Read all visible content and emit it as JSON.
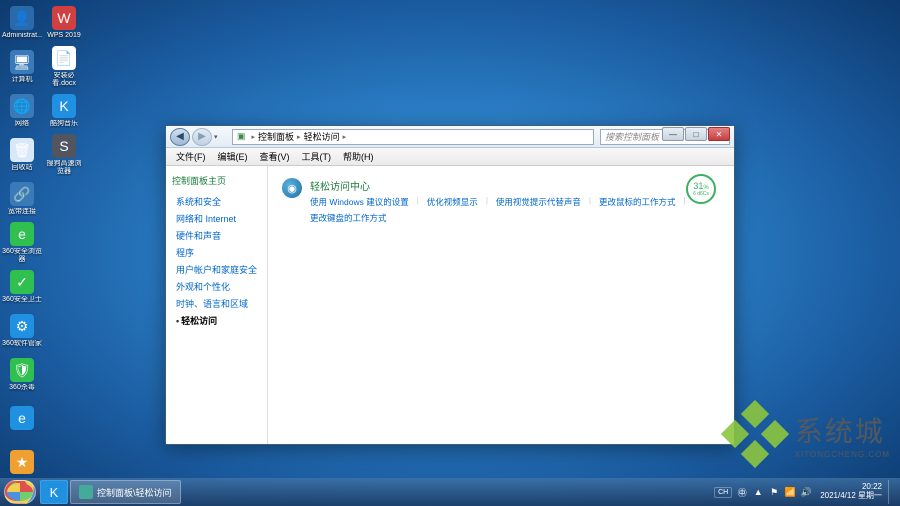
{
  "desktop": {
    "col1": [
      {
        "label": "Administrat...",
        "color": "#2a6aaa",
        "glyph": "👤"
      },
      {
        "label": "计算机",
        "color": "#3a7ab8",
        "glyph": "🖥"
      },
      {
        "label": "网络",
        "color": "#3a7ab8",
        "glyph": "🌐"
      },
      {
        "label": "回收站",
        "color": "#d8e8f8",
        "glyph": "🗑"
      },
      {
        "label": "宽带连接",
        "color": "#3a7ab8",
        "glyph": "🔗"
      },
      {
        "label": "360安全浏览器",
        "color": "#30c050",
        "glyph": "e"
      },
      {
        "label": "360安全卫士",
        "color": "#30c050",
        "glyph": "✓"
      },
      {
        "label": "360软件管家",
        "color": "#2090e0",
        "glyph": "⚙"
      },
      {
        "label": "360杀毒",
        "color": "#30c050",
        "glyph": "🛡"
      },
      {
        "label": "",
        "color": "#2090e0",
        "glyph": "e"
      },
      {
        "label": "",
        "color": "#f0a030",
        "glyph": "★"
      }
    ],
    "col2": [
      {
        "label": "WPS 2019",
        "color": "#d04040",
        "glyph": "W"
      },
      {
        "label": "安装必看.docx",
        "color": "#ffffff",
        "glyph": "📄"
      },
      {
        "label": "酷狗音乐",
        "color": "#2090e0",
        "glyph": "K"
      },
      {
        "label": "搜狗高速浏览器",
        "color": "#505560",
        "glyph": "S"
      }
    ]
  },
  "window": {
    "breadcrumb": {
      "root": "控制面板",
      "current": "轻松访问"
    },
    "search_placeholder": "搜索控制面板",
    "menu": [
      "文件(F)",
      "编辑(E)",
      "查看(V)",
      "工具(T)",
      "帮助(H)"
    ],
    "sidebar": {
      "header": "控制面板主页",
      "items": [
        {
          "label": "系统和安全",
          "active": false
        },
        {
          "label": "网络和 Internet",
          "active": false
        },
        {
          "label": "硬件和声音",
          "active": false
        },
        {
          "label": "程序",
          "active": false
        },
        {
          "label": "用户帐户和家庭安全",
          "active": false
        },
        {
          "label": "外观和个性化",
          "active": false
        },
        {
          "label": "时钟、语言和区域",
          "active": false
        },
        {
          "label": "轻松访问",
          "active": true
        }
      ]
    },
    "content": {
      "title": "轻松访问中心",
      "links": [
        "使用 Windows 建议的设置",
        "优化视频显示",
        "使用视觉提示代替声音",
        "更改鼠标的工作方式",
        "更改键盘的工作方式"
      ]
    },
    "badge": {
      "value": "31",
      "unit": "%",
      "sub": "6 d6Cs"
    },
    "ctrl": {
      "min": "—",
      "max": "□",
      "close": "✕"
    }
  },
  "taskbar": {
    "task_label": "控制面板\\轻松访问",
    "lang": "CH",
    "ime": "㊥",
    "clock": {
      "time": "20:22",
      "date": "2021/4/12 星期一"
    }
  },
  "watermark": {
    "text": "系统城",
    "url": "XITONGCHENG.COM"
  }
}
